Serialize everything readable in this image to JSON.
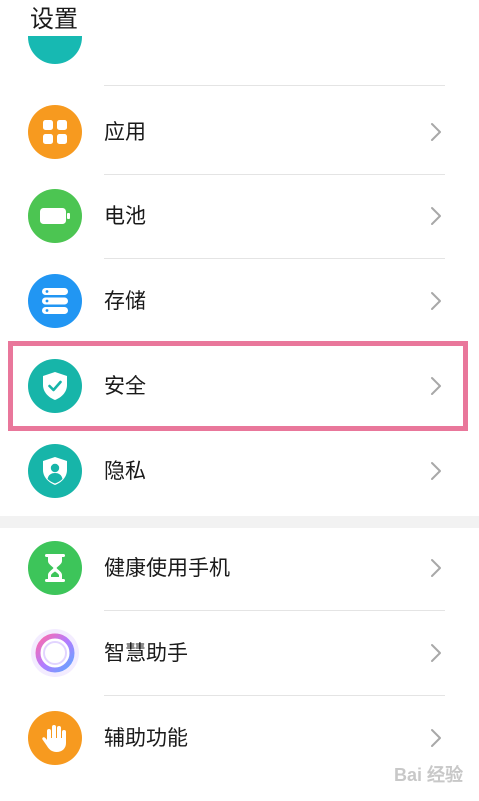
{
  "header": {
    "title": "设置"
  },
  "items": [
    {
      "key": "apps",
      "label": "应用",
      "icon": "apps-grid-icon",
      "color": "#f79a1f"
    },
    {
      "key": "battery",
      "label": "电池",
      "icon": "battery-icon",
      "color": "#4cc552"
    },
    {
      "key": "storage",
      "label": "存储",
      "icon": "storage-icon",
      "color": "#2196f3"
    },
    {
      "key": "security",
      "label": "安全",
      "icon": "shield-check-icon",
      "color": "#17b5a9"
    },
    {
      "key": "privacy",
      "label": "隐私",
      "icon": "privacy-user-icon",
      "color": "#17b5a9"
    },
    {
      "key": "digital-balance",
      "label": "健康使用手机",
      "icon": "hourglass-icon",
      "color": "#3dc55a"
    },
    {
      "key": "assistant",
      "label": "智慧助手",
      "icon": "assistant-ring-icon",
      "color": "#b47bff"
    },
    {
      "key": "accessibility",
      "label": "辅助功能",
      "icon": "hand-icon",
      "color": "#f79a1f"
    }
  ],
  "highlight": {
    "target": "security",
    "color": "#e9779b"
  },
  "watermark": {
    "text": "Bai 经验"
  }
}
